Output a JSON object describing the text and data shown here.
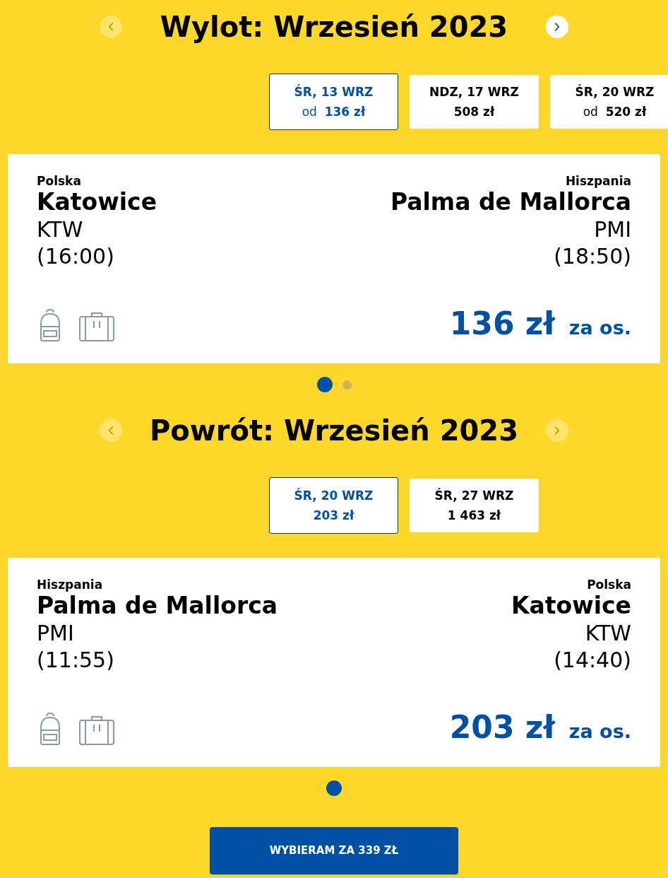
{
  "sections": [
    {
      "title": "Wylot: Wrzesień 2023",
      "prev_arrow": {
        "disabled": true
      },
      "next_arrow": {
        "disabled": false
      },
      "dates": [
        {
          "date": "ŚR, 13 WRZ",
          "prefix": "od",
          "price": "136 zł",
          "selected": true
        },
        {
          "date": "NDZ, 17 WRZ",
          "price": "508 zł",
          "selected": false
        },
        {
          "date": "ŚR, 20 WRZ",
          "prefix": "od",
          "price": "520 zł",
          "selected": false
        }
      ],
      "flight": {
        "from": {
          "country": "Polska",
          "city": "Katowice",
          "code": "KTW",
          "time": "(16:00)"
        },
        "to": {
          "country": "Hiszpania",
          "city": "Palma de Mallorca",
          "code": "PMI",
          "time": "(18:50)"
        },
        "price": "136 zł",
        "per": "za os."
      },
      "pages": [
        {
          "selected": true
        },
        {
          "selected": false
        }
      ]
    },
    {
      "title": "Powrót: Wrzesień 2023",
      "prev_arrow": {
        "disabled": true
      },
      "next_arrow": {
        "disabled": true
      },
      "dates": [
        {
          "date": "ŚR, 20 WRZ",
          "price": "203 zł",
          "selected": true
        },
        {
          "date": "ŚR, 27 WRZ",
          "price": "1 463 zł",
          "selected": false
        }
      ],
      "flight": {
        "from": {
          "country": "Hiszpania",
          "city": "Palma de Mallorca",
          "code": "PMI",
          "time": "(11:55)"
        },
        "to": {
          "country": "Polska",
          "city": "Katowice",
          "code": "KTW",
          "time": "(14:40)"
        },
        "price": "203 zł",
        "per": "za os."
      },
      "pages": [
        {
          "selected": true
        }
      ]
    }
  ],
  "select_button": "WYBIERAM ZA 339 ZŁ"
}
